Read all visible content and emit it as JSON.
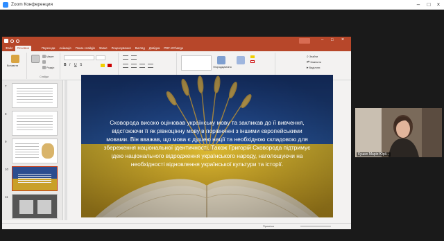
{
  "zoom": {
    "title": "Zoom Конференция"
  },
  "powerpoint": {
    "title_center": "",
    "search_hint": "",
    "tabs": [
      {
        "label": "Файл",
        "active": false
      },
      {
        "label": "Основна",
        "active": true
      },
      {
        "label": "",
        "active": false
      },
      {
        "label": "",
        "active": false
      },
      {
        "label": "Переходи",
        "active": false
      },
      {
        "label": "Анімація",
        "active": false
      },
      {
        "label": "Показ слайдів",
        "active": false
      },
      {
        "label": "Запис",
        "active": false
      },
      {
        "label": "Рецензування",
        "active": false
      },
      {
        "label": "Вигляд",
        "active": false
      },
      {
        "label": "Довідка",
        "active": false
      },
      {
        "label": "PDF-XChange",
        "active": false
      },
      {
        "label": "",
        "active": false
      }
    ],
    "ribbon": {
      "clipboard": {
        "paste": "Вставити",
        "label": ""
      },
      "slides": {
        "new_slide": "",
        "layout": "Макет",
        "reset": "",
        "section": "Розділ",
        "label": "Слайди"
      },
      "font": {
        "label": "Шрифт"
      },
      "paragraph": {
        "label": "Абзац"
      },
      "drawing": {
        "label": "Малювання",
        "arrange": "Упорядкування",
        "quick_styles": ""
      },
      "editing": {
        "find": "Знайти",
        "replace": "Замінити",
        "select": "Виділити",
        "label": "Редагування"
      }
    },
    "thumbnails": [
      {
        "num": "7",
        "selected": false
      },
      {
        "num": "8",
        "selected": false
      },
      {
        "num": "9",
        "selected": false
      },
      {
        "num": "10",
        "selected": true
      },
      {
        "num": "11",
        "selected": false
      }
    ],
    "slide": {
      "text": "Сковорода високо оцінював українську мову та закликав до її вивчення, відстоюючи її як рівноцінну мову в порівнянні з іншими європейськими мовами. Він вважав, що мова є душею нації та необхідною складовою для збереження національної ідентичності. Також Григорій Сковорода підтримує ідею національного відродження українського народу, наголошуючи на необхідності відновлення української культури та історії."
    },
    "status": {
      "slide_pos": "",
      "language": "",
      "accessibility": "",
      "notes": "Примітки",
      "zoom": ""
    }
  },
  "camera": {
    "name": "Кушко Марія Юрії..."
  },
  "colors": {
    "ppt_accent": "#b7472a",
    "flag_blue": "#1f3f86",
    "flag_yellow": "#e8c02a"
  }
}
